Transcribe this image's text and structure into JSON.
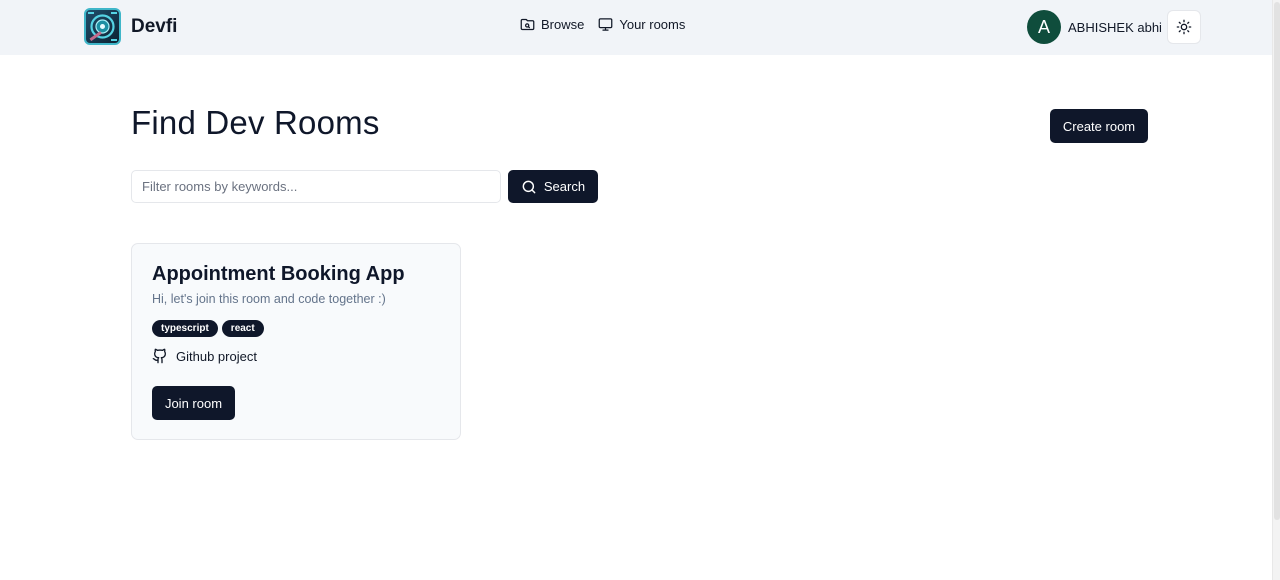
{
  "brand": {
    "name": "Devfi",
    "logo_icon": "app-logo-icon"
  },
  "nav": {
    "items": [
      {
        "label": "Browse",
        "icon": "folder-search-icon"
      },
      {
        "label": "Your rooms",
        "icon": "monitor-icon"
      }
    ]
  },
  "user": {
    "avatar_initial": "A",
    "name": "ABHISHEK abhi"
  },
  "theme_toggle": {
    "icon": "sun-icon"
  },
  "main": {
    "title": "Find Dev Rooms",
    "create_label": "Create room",
    "search": {
      "placeholder": "Filter rooms by keywords...",
      "value": "",
      "button_label": "Search"
    }
  },
  "rooms": [
    {
      "title": "Appointment Booking App",
      "description": "Hi, let's join this room and code together :)",
      "tags": [
        "typescript",
        "react"
      ],
      "github_label": "Github project",
      "join_label": "Join room"
    }
  ],
  "colors": {
    "primary": "#0f172a",
    "header_bg": "#f1f4f8",
    "avatar_bg": "#0f4d3c",
    "card_bg": "#f8fafc",
    "muted_text": "#64748b"
  }
}
